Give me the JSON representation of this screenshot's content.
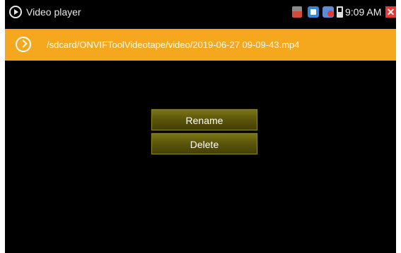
{
  "titlebar": {
    "app_icon": "play-circle-icon",
    "app_title": "Video player",
    "status_icons": [
      "sd-card-icon",
      "shield-icon",
      "blocked-icon",
      "battery-icon",
      "close-icon"
    ],
    "time": "9:09 AM",
    "close_glyph": "✕"
  },
  "pathbar": {
    "icon": "play-chevron-icon",
    "path": "/sdcard/ONVIFToolVideotape/video/2019-06-27 09-09-43.mp4",
    "background_color": "#f5a81e"
  },
  "menu": {
    "rename_label": "Rename",
    "delete_label": "Delete"
  }
}
